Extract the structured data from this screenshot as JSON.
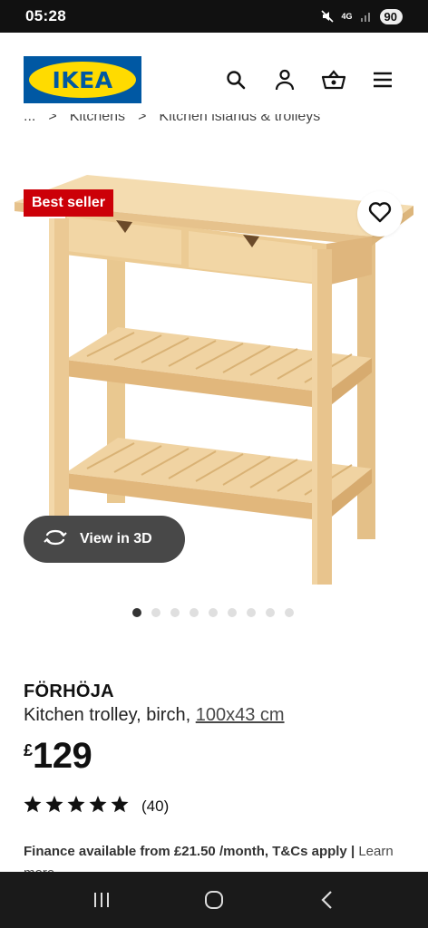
{
  "status_bar": {
    "time": "05:28",
    "network": "4G",
    "battery": "90"
  },
  "header": {
    "logo_text": "IKEA",
    "icons": [
      "search-icon",
      "user-icon",
      "basket-icon",
      "menu-icon"
    ]
  },
  "breadcrumb": {
    "items": [
      "...",
      "Kitchens",
      "Kitchen islands & trolleys"
    ],
    "separator": ">"
  },
  "gallery": {
    "badge": "Best seller",
    "view_3d_label": "View in 3D",
    "image_count": 9,
    "active_image_index": 0
  },
  "product": {
    "name": "FÖRHÖJA",
    "description": "Kitchen trolley, birch,",
    "measurement": "100x43 cm",
    "currency": "£",
    "price": "129",
    "rating_stars": 5,
    "review_count": "(40)",
    "finance_text": "Finance available from £21.50 /month, T&Cs apply",
    "finance_link": "Learn more"
  },
  "colors": {
    "ikea_blue": "#0058a3",
    "ikea_yellow": "#ffdb00",
    "badge_red": "#cc0008",
    "wood_light": "#f1d5a8",
    "wood_mid": "#e6c08a"
  }
}
